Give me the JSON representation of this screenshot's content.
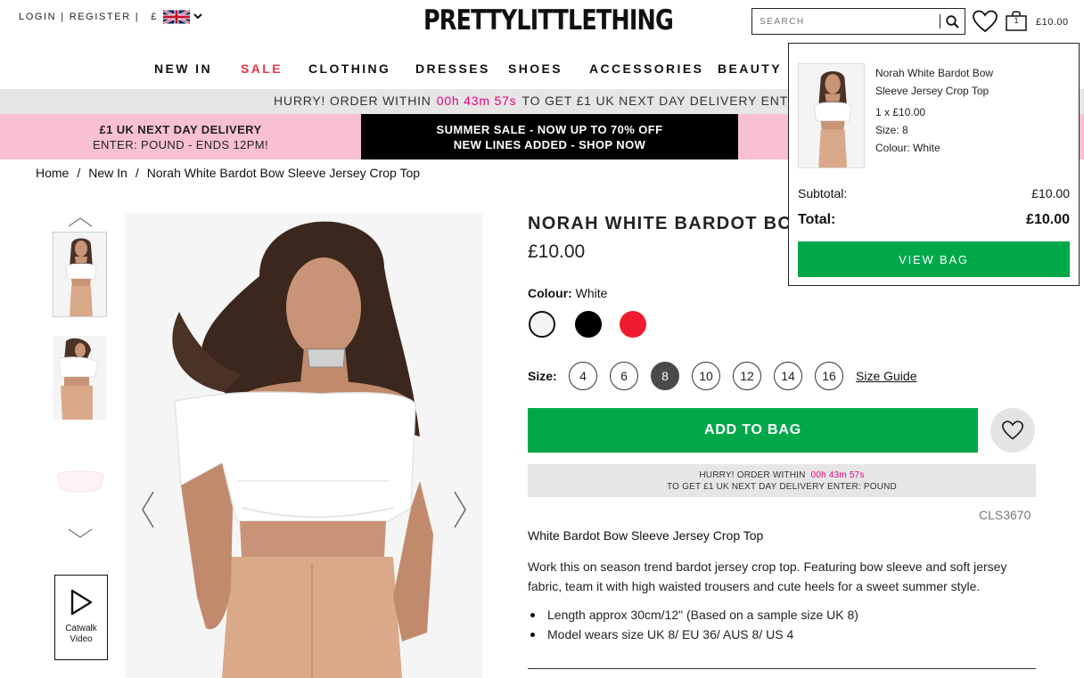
{
  "header": {
    "login": "LOGIN",
    "register": "REGISTER",
    "currency": "£",
    "logo": "PRETTYLITTLETHING",
    "search_placeholder": "SEARCH",
    "bag_count": "1",
    "bag_total": "£10.00"
  },
  "nav": [
    {
      "label": "NEW IN"
    },
    {
      "label": "SALE"
    },
    {
      "label": "CLOTHING"
    },
    {
      "label": "DRESSES"
    },
    {
      "label": "SHOES"
    },
    {
      "label": "ACCESSORIES"
    },
    {
      "label": "BEAUTY"
    }
  ],
  "hurry_strip": {
    "text_a": "HURRY! ORDER WITHIN",
    "countdown": "00h 43m 57s",
    "text_b": "TO GET £1 UK NEXT DAY DELIVERY ENTER: POUND"
  },
  "promos": {
    "left_line1": "£1 UK NEXT DAY DELIVERY",
    "left_line2": "ENTER: POUND - ENDS 12PM!",
    "mid_line1": "SUMMER SALE - NOW UP TO 70% OFF",
    "mid_line2": "NEW LINES ADDED - SHOP NOW"
  },
  "breadcrumb": [
    "Home",
    "New In",
    "Norah White Bardot Bow Sleeve Jersey Crop Top"
  ],
  "gallery": {
    "catwalk_line1": "Catwalk",
    "catwalk_line2": "Video"
  },
  "product": {
    "title": "NORAH WHITE BARDOT BOW",
    "price": "£10.00",
    "colour_label": "Colour:",
    "colour_value": "White",
    "colours": [
      "white",
      "black",
      "red"
    ],
    "size_label": "Size:",
    "sizes": [
      "4",
      "6",
      "8",
      "10",
      "12",
      "14",
      "16"
    ],
    "selected_size": "8",
    "size_guide": "Size Guide",
    "add_to_bag": "ADD TO BAG",
    "hurry_a": "HURRY! ORDER WITHIN",
    "hurry_countdown": "00h 43m 57s",
    "hurry_b": "TO GET £1 UK NEXT DAY DELIVERY ENTER: POUND",
    "sku": "CLS3670",
    "subtitle": "White Bardot Bow Sleeve Jersey Crop Top",
    "description": "Work this on season trend bardot jersey crop top. Featuring bow sleeve and soft jersey fabric, team it with high waisted trousers and cute heels for a sweet summer style.",
    "bullets": [
      "Length approx 30cm/12\" (Based on a sample size UK 8)",
      "Model wears size UK 8/ EU 36/ AUS 8/ US 4"
    ]
  },
  "minibag": {
    "item_name": "Norah White Bardot Bow Sleeve Jersey Crop Top",
    "qty_price": "1 x £10.00",
    "size": "Size: 8",
    "colour": "Colour: White",
    "subtotal_label": "Subtotal:",
    "subtotal_value": "£10.00",
    "total_label": "Total:",
    "total_value": "£10.00",
    "view_bag": "VIEW BAG"
  },
  "colors": {
    "accent_green": "#00a84a",
    "sale_red": "#e8334a",
    "promo_pink": "#f9c0d5",
    "countdown_magenta": "#e6007e"
  }
}
